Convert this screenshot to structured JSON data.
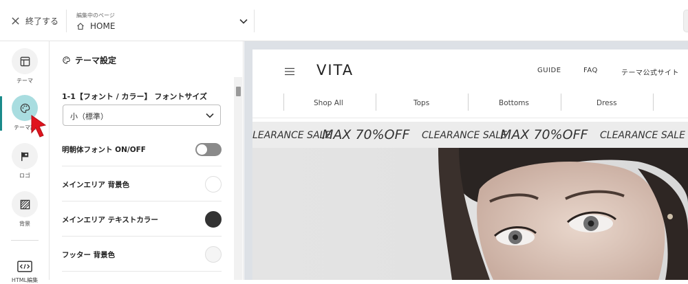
{
  "topbar": {
    "exit_label": "終了する",
    "page_selector": {
      "caption": "編集中のページ",
      "value": "HOME"
    }
  },
  "rail": {
    "items": [
      {
        "label": "テーマ",
        "icon": "layout-icon"
      },
      {
        "label": "テーマ設",
        "icon": "palette-icon",
        "active": true
      },
      {
        "label": "ロゴ",
        "icon": "flag-icon"
      },
      {
        "label": "背景",
        "icon": "texture-icon"
      },
      {
        "label": "HTML編集",
        "icon": "code-icon"
      }
    ]
  },
  "panel": {
    "title": "テーマ設定",
    "font_size_label": "1-1【フォント / カラー】 フォントサイズ",
    "font_size_value": "小（標準）",
    "rows": [
      {
        "label": "明朝体フォント ON/OFF",
        "control": "toggle",
        "on": false
      },
      {
        "label": "メインエリア 背景色",
        "control": "swatch",
        "color": "#ffffff"
      },
      {
        "label": "メインエリア テキストカラー",
        "control": "swatch",
        "color": "#333333"
      },
      {
        "label": "フッター 背景色",
        "control": "swatch",
        "color": "#f5f5f5"
      }
    ]
  },
  "preview": {
    "logo": "VITA",
    "nav": [
      "GUIDE",
      "FAQ",
      "テーマ公式サイト"
    ],
    "categories": [
      "Shop All",
      "Tops",
      "Bottoms",
      "Dress"
    ],
    "banner": {
      "segments": [
        {
          "small": "LEARANCE SALE",
          "large": "MAX 70%OFF"
        },
        {
          "small": "CLEARANCE SALE",
          "large": "MAX 70%OFF"
        },
        {
          "small": "CLEARANCE SALE",
          "large": ""
        }
      ]
    }
  },
  "colors": {
    "accent": "#1a8a8a",
    "active_circle": "#a9dde0",
    "cursor": "#e0141e",
    "preview_bg": "#dde1e6"
  }
}
